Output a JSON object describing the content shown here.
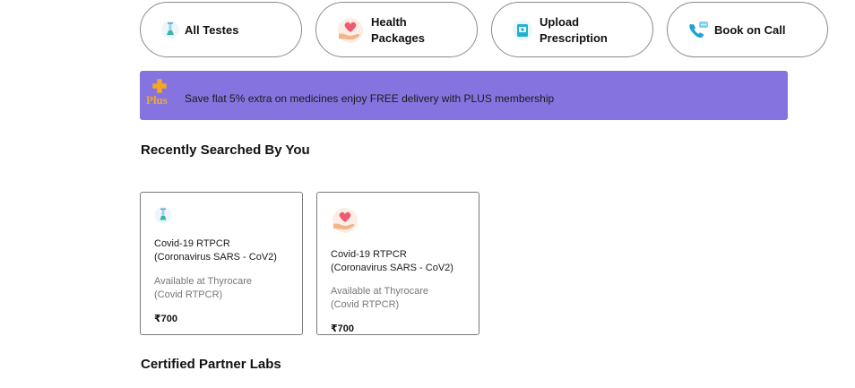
{
  "quick_actions": [
    {
      "label": "All Testes",
      "icon": "test-tube-icon"
    },
    {
      "label": "Health\nPackages",
      "icon": "heart-hand-icon"
    },
    {
      "label": "Upload\nPrescription",
      "icon": "prescription-icon"
    },
    {
      "label": "Book on Call",
      "icon": "phone-call-icon"
    }
  ],
  "plus_banner": {
    "logo_text": "Plus",
    "message": "Save flat 5% extra on medicines enjoy FREE delivery with PLUS membership",
    "background": "#8574df",
    "accent": "#f5a623"
  },
  "recent": {
    "title": "Recently Searched By You",
    "cards": [
      {
        "icon": "test-tube-icon",
        "name_line1": "Covid-19 RTPCR",
        "name_line2": "(Coronavirus SARS - CoV2)",
        "avail_line1": "Available at Thyrocare",
        "avail_line2": "(Covid RTPCR)",
        "price": "₹700"
      },
      {
        "icon": "heart-hand-icon",
        "name_line1": "Covid-19 RTPCR",
        "name_line2": "(Coronavirus SARS - CoV2)",
        "avail_line1": "Available at Thyrocare",
        "avail_line2": "(Covid RTPCR)",
        "price": "₹700"
      }
    ]
  },
  "partners": {
    "title": "Certified Partner Labs"
  }
}
